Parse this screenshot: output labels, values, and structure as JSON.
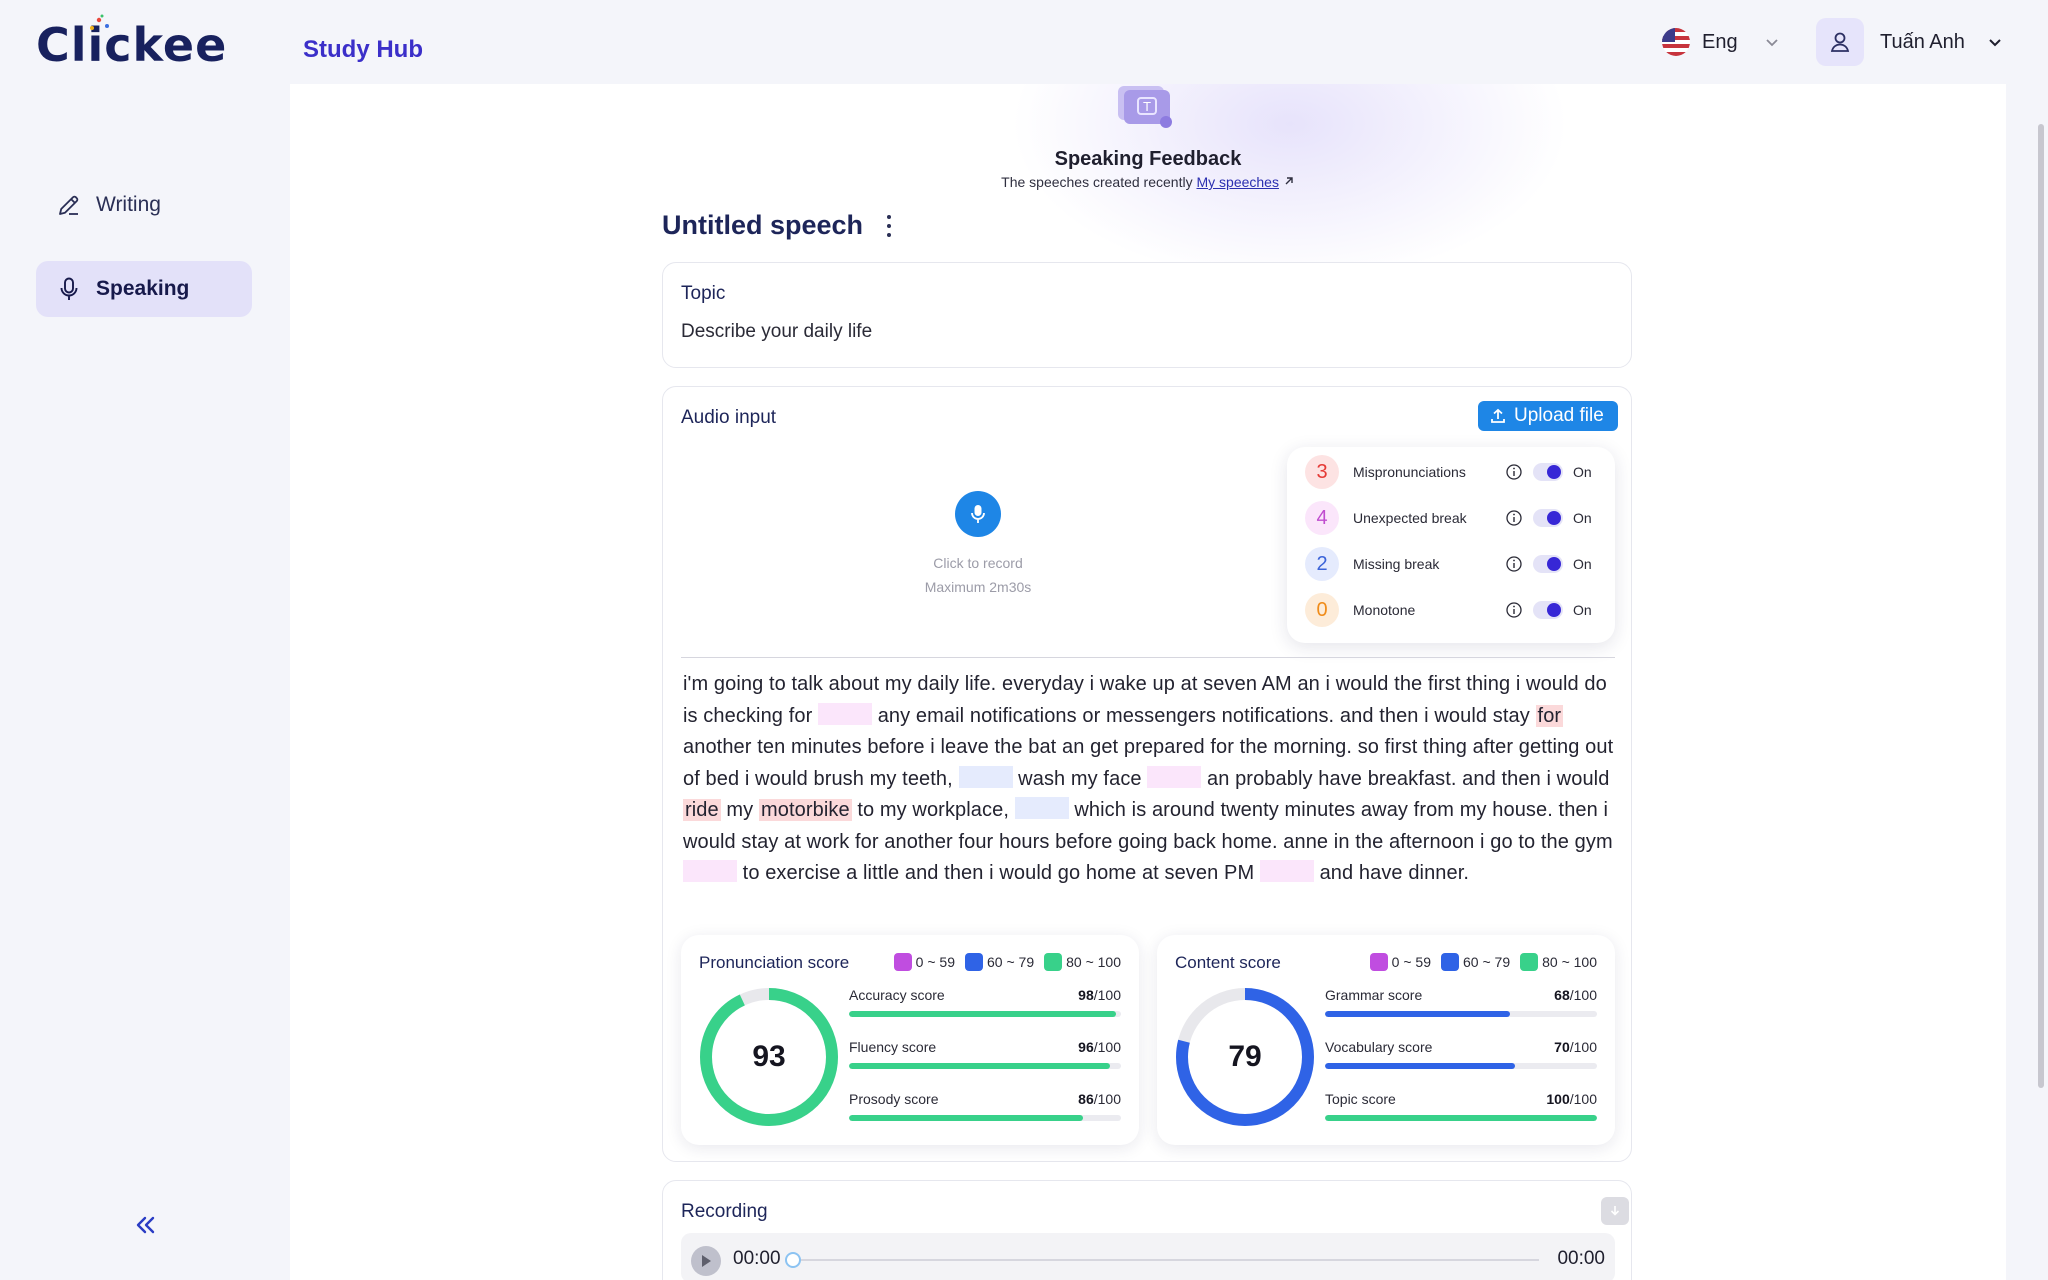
{
  "header": {
    "logo_text": "Clickee",
    "section": "Study Hub",
    "language": "Eng",
    "user_name": "Tuấn Anh"
  },
  "sidebar": {
    "items": [
      {
        "label": "Writing",
        "icon": "pencil-icon",
        "active": false
      },
      {
        "label": "Speaking",
        "icon": "microphone-icon",
        "active": true
      }
    ],
    "collapse_icon": "double-chevron-left-icon"
  },
  "hero": {
    "title": "Speaking Feedback",
    "subtitle": "The speeches created recently",
    "link": "My speeches"
  },
  "speech": {
    "title": "Untitled speech",
    "topic_label": "Topic",
    "topic": "Describe your daily life"
  },
  "audio": {
    "label": "Audio input",
    "upload_label": "Upload file",
    "mic_hint_1": "Click to record",
    "mic_hint_2": "Maximum 2m30s",
    "issues": [
      {
        "count": "3",
        "name": "Mispronunciations",
        "state": "On",
        "color": "#e53935",
        "bg": "#fde3e3"
      },
      {
        "count": "4",
        "name": "Unexpected break",
        "state": "On",
        "color": "#c04dcf",
        "bg": "#fbe6fb"
      },
      {
        "count": "2",
        "name": "Missing break",
        "state": "On",
        "color": "#3b63d8",
        "bg": "#e5ebfd"
      },
      {
        "count": "0",
        "name": "Monotone",
        "state": "On",
        "color": "#f08c1a",
        "bg": "#fdecd9"
      }
    ],
    "transcript": [
      {
        "t": "i'm going to talk about my daily life. everyday i wake up at seven AM an i would the first thing i would do is checking for"
      },
      {
        "gap": "unexpected"
      },
      {
        "t": "any email notifications or messengers notifications. and then i would stay"
      },
      {
        "mis": "for"
      },
      {
        "t": "another ten minutes before i leave the bat an get prepared for the morning. so first thing after getting out of bed i would brush my teeth,"
      },
      {
        "gap": "missing"
      },
      {
        "t": "wash my face"
      },
      {
        "gap": "unexpected"
      },
      {
        "t": "an probably have breakfast. and then i would"
      },
      {
        "mis": "ride"
      },
      {
        "t": "my"
      },
      {
        "mis": "motorbike"
      },
      {
        "t": "to my workplace,"
      },
      {
        "gap": "missing"
      },
      {
        "t": "which is around twenty minutes away from my house. then i would stay at work for another four hours before going back home. anne in the afternoon i go to the gym"
      },
      {
        "gap": "unexpected"
      },
      {
        "t": "to exercise a little and then i would go home at seven PM"
      },
      {
        "gap": "unexpected"
      },
      {
        "t": "and have dinner."
      }
    ]
  },
  "legend": [
    {
      "label": "0 ~ 59",
      "color": "#c04de0"
    },
    {
      "label": "60 ~ 79",
      "color": "#2f63e6"
    },
    {
      "label": "80 ~ 100",
      "color": "#38d18a"
    }
  ],
  "scores": {
    "pronunciation": {
      "title": "Pronunciation score",
      "total": "93",
      "total_value": 93,
      "color": "#38d18a",
      "metrics": [
        {
          "name": "Accuracy score",
          "value": "98",
          "max": "/100",
          "pct": 98,
          "color": "#38d18a"
        },
        {
          "name": "Fluency score",
          "value": "96",
          "max": "/100",
          "pct": 96,
          "color": "#38d18a"
        },
        {
          "name": "Prosody score",
          "value": "86",
          "max": "/100",
          "pct": 86,
          "color": "#38d18a"
        }
      ]
    },
    "content": {
      "title": "Content score",
      "total": "79",
      "total_value": 79,
      "color": "#2f63e6",
      "metrics": [
        {
          "name": "Grammar score",
          "value": "68",
          "max": "/100",
          "pct": 68,
          "color": "#2f63e6"
        },
        {
          "name": "Vocabulary score",
          "value": "70",
          "max": "/100",
          "pct": 70,
          "color": "#2f63e6"
        },
        {
          "name": "Topic score",
          "value": "100",
          "max": "/100",
          "pct": 100,
          "color": "#38d18a"
        }
      ]
    }
  },
  "recording": {
    "label": "Recording",
    "current_time": "00:00",
    "end_time": "00:00",
    "progress": 0
  }
}
